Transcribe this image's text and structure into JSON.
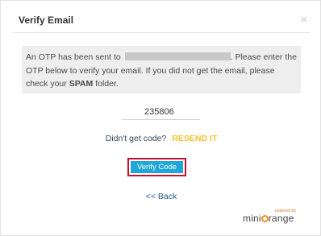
{
  "modal": {
    "title": "Verify Email",
    "close_glyph": "×"
  },
  "message": {
    "part1": "An OTP has been sent to",
    "part2": ". Please enter the OTP below to verify your email. If you did not get the email, please check your",
    "spam": "SPAM",
    "part3": "folder."
  },
  "otp": {
    "value": "235806"
  },
  "resend": {
    "prompt": "Didn't get code?",
    "link": "RESEND IT"
  },
  "verify": {
    "label": "Verify Code"
  },
  "back": {
    "label": "<< Back"
  },
  "brand": {
    "powered": "powered by",
    "name_left": "mini",
    "name_right": "range"
  },
  "colors": {
    "accent_button": "#1ea7d7",
    "resend_link": "#f3c232",
    "focus_border": "#c8102e",
    "brand_orange": "#f28c28"
  }
}
